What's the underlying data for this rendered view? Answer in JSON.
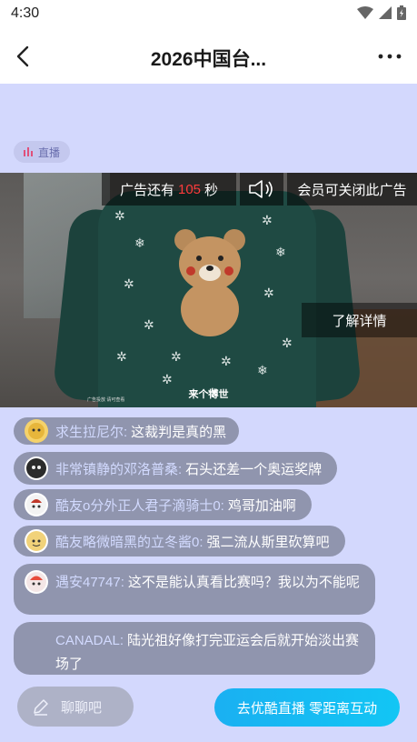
{
  "status_bar": {
    "time": "4:30"
  },
  "header": {
    "title": "2026中国台..."
  },
  "live_badge": {
    "label": "直播"
  },
  "ad": {
    "countdown_prefix": "广告还有",
    "countdown_seconds": "105",
    "countdown_suffix": "秒",
    "vip_close": "会员可关闭此广告",
    "detail": "了解详情",
    "caption": "来个博世",
    "fine_print": "广告投放 请可查看"
  },
  "chat": {
    "messages": [
      {
        "name": "求生拉尼尔:",
        "text": "这裁判是真的黑"
      },
      {
        "name": "非常镇静的邓洛普桑:",
        "text": "石头还差一个奥运奖牌"
      },
      {
        "name": "酷友o分外正人君子滴骑士0:",
        "text": "鸡哥加油啊"
      },
      {
        "name": "酷友略微暗黑的立冬酱0:",
        "text": "强二流从斯里砍算吧"
      },
      {
        "name": "遇安47747:",
        "text": "这不是能认真看比赛吗？我以为不能呢"
      },
      {
        "name": "CANADAL:",
        "text": "陆光祖好像打完亚运会后就开始淡出赛场了"
      }
    ]
  },
  "footer": {
    "input_placeholder": "聊聊吧",
    "cta_label": "去优酷直播 零距离互动"
  },
  "colors": {
    "accent": "#1ab0f2",
    "countdown": "#ff3b3b",
    "background": "#d3d8fd"
  }
}
